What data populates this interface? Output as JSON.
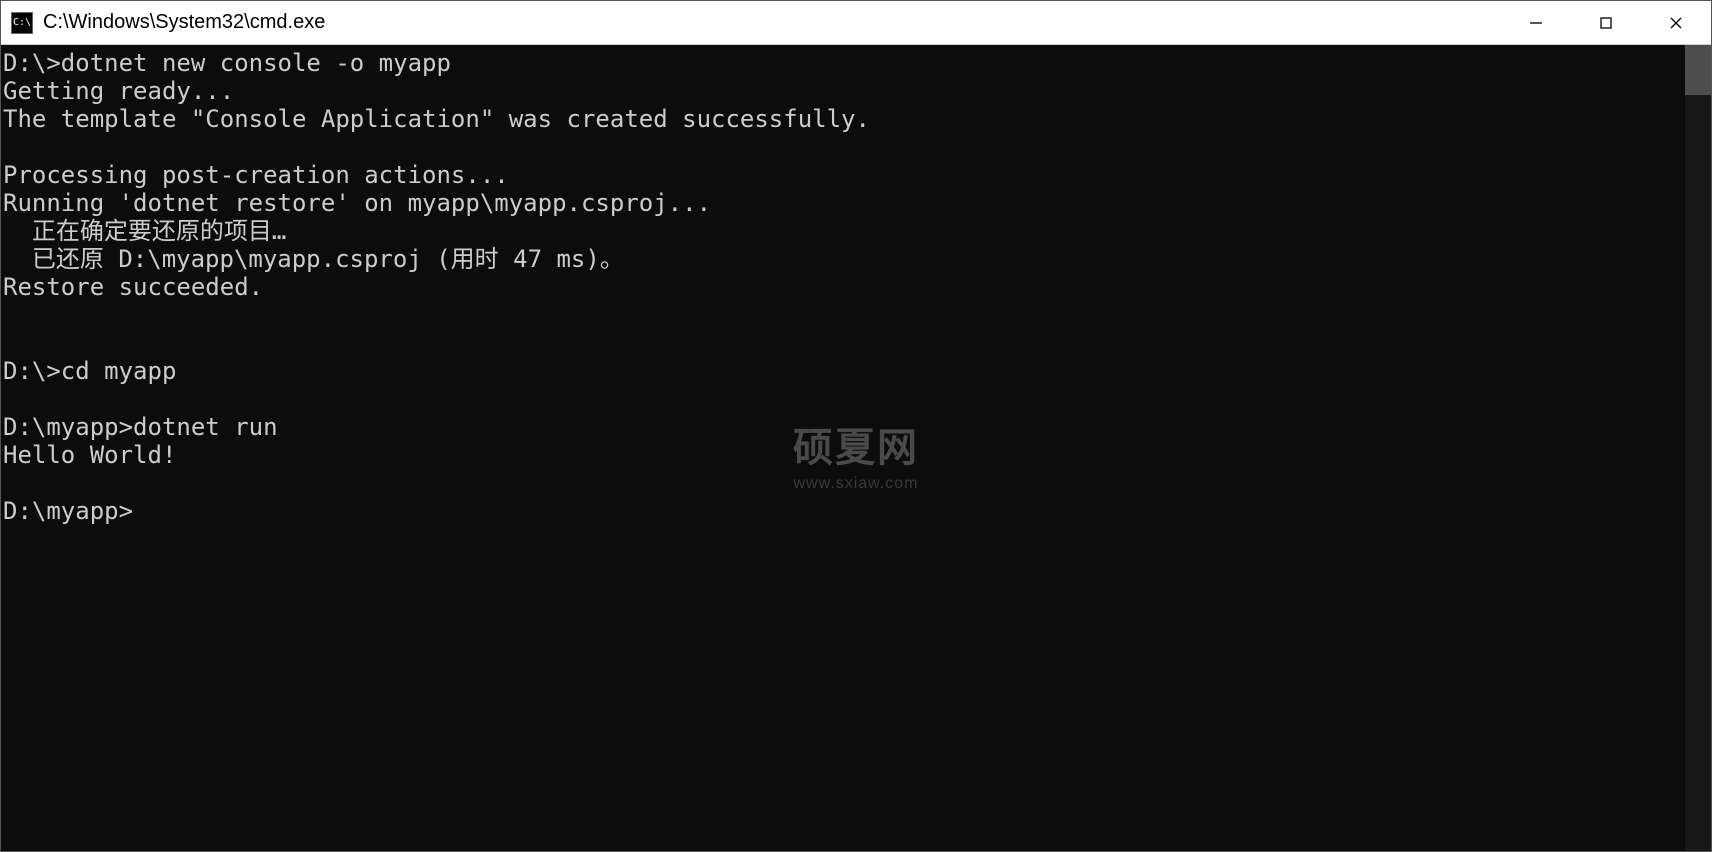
{
  "window": {
    "title": "C:\\Windows\\System32\\cmd.exe",
    "icon_label": "C:\\"
  },
  "terminal": {
    "lines": [
      "D:\\>dotnet new console -o myapp",
      "Getting ready...",
      "The template \"Console Application\" was created successfully.",
      "",
      "Processing post-creation actions...",
      "Running 'dotnet restore' on myapp\\myapp.csproj...",
      "  正在确定要还原的项目…",
      "  已还原 D:\\myapp\\myapp.csproj (用时 47 ms)。",
      "Restore succeeded.",
      "",
      "",
      "D:\\>cd myapp",
      "",
      "D:\\myapp>dotnet run",
      "Hello World!",
      "",
      "D:\\myapp>"
    ]
  },
  "watermark": {
    "main": "硕夏网",
    "sub": "www.sxiaw.com"
  }
}
